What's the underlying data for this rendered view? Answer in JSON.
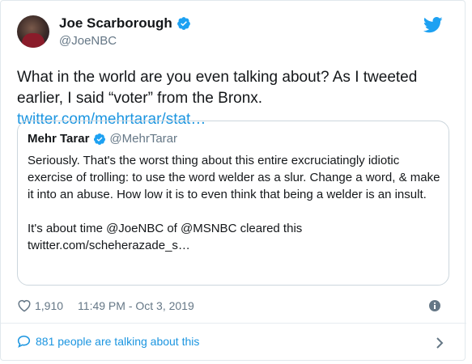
{
  "author": {
    "name": "Joe Scarborough",
    "handle": "@JoeNBC"
  },
  "tweet": {
    "text_line1": "What in the world are you even talking about? As I tweeted",
    "text_line2_prefix": "earlier, I said “voter” from the Bronx. ",
    "link": "twitter.com/mehrtarar/stat…"
  },
  "quote": {
    "name": "Mehr Tarar",
    "handle": "@MehrTarar",
    "paragraph1": "Seriously. That's the worst thing about this entire excruciatingly idiotic exercise of trolling: to use the word welder as a slur. Change a word, & make it into an abuse. How low it is to even think that being a welder is an insult.",
    "paragraph2": "It's about time @JoeNBC of @MSNBC cleared this twitter.com/scheherazade_s…"
  },
  "meta": {
    "likes": "1,910",
    "timestamp": "11:49 PM - Oct 3, 2019"
  },
  "footer": {
    "talking": "881 people are talking about this"
  },
  "icons": {
    "verified": "verified-badge-icon",
    "twitter": "twitter-bird-icon",
    "heart": "heart-icon",
    "info": "info-icon",
    "comment": "speech-bubble-icon",
    "chevron": "chevron-right-icon"
  },
  "colors": {
    "accent": "#1da1f2",
    "link": "#1b95e0",
    "muted": "#657786",
    "text": "#14171a"
  }
}
